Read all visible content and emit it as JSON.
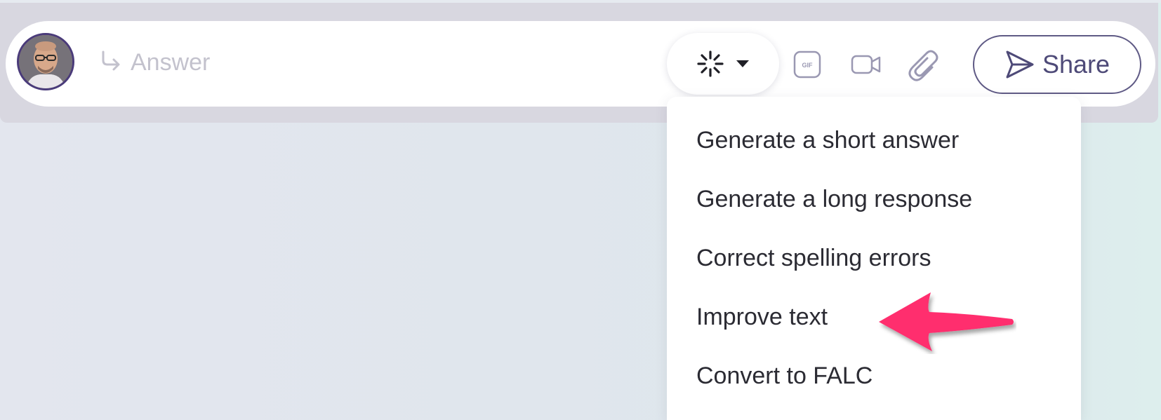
{
  "composer": {
    "placeholder": "Answer"
  },
  "toolbar": {
    "ai_icon": "sparkle-burst-icon",
    "ai_caret_icon": "caret-down-icon",
    "gif_icon": "gif-icon",
    "gif_icon_text": "GIF",
    "video_icon": "video-camera-icon",
    "attach_icon": "paperclip-icon",
    "share_icon": "send-icon",
    "share_label": "Share"
  },
  "ai_menu": {
    "items": [
      {
        "label": "Generate a short answer"
      },
      {
        "label": "Generate a long response"
      },
      {
        "label": "Correct spelling errors"
      },
      {
        "label": "Improve text"
      },
      {
        "label": "Convert to FALC"
      }
    ]
  },
  "annotation": {
    "icon": "pointer-arrow-icon",
    "color": "#ff2d6e"
  },
  "colors": {
    "accent": "#4e4a78",
    "text": "#2b2b33",
    "placeholder": "#c3c2cd",
    "frame": "#d8d7e0"
  }
}
